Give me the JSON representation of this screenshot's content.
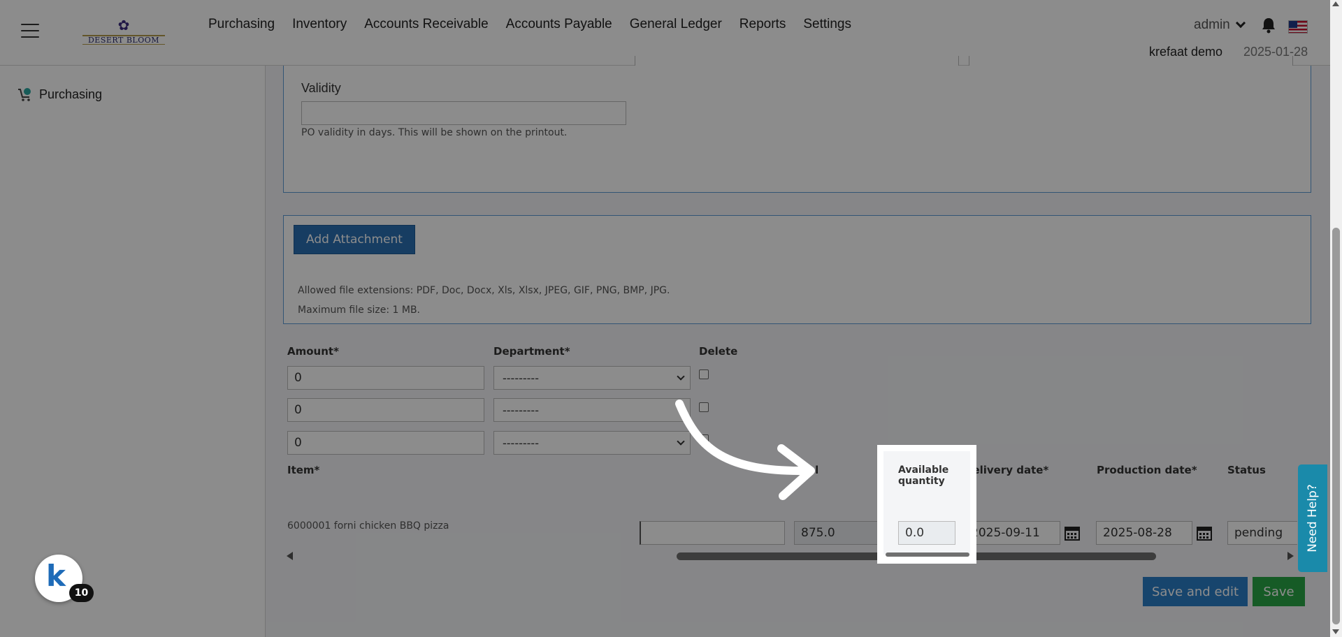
{
  "header": {
    "logo_text": "DESERT BLOOM",
    "nav": [
      "Purchasing",
      "Inventory",
      "Accounts Receivable",
      "Accounts Payable",
      "General Ledger",
      "Reports",
      "Settings"
    ],
    "user": "admin",
    "company": "krefaat demo",
    "date": "2025-01-28"
  },
  "sidebar": {
    "items": [
      {
        "label": "Purchasing",
        "icon": "cart-icon"
      }
    ]
  },
  "validity": {
    "label": "Validity",
    "value": "",
    "help": "PO validity in days. This will be shown on the printout."
  },
  "attachment": {
    "button": "Add Attachment",
    "extensions": "Allowed file extensions: PDF, Doc, Docx, Xls, Xlsx, JPEG, GIF, PNG, BMP, JPG.",
    "max_size": "Maximum file size: 1 MB."
  },
  "split": {
    "headers": {
      "amount": "Amount*",
      "department": "Department*",
      "delete": "Delete"
    },
    "rows": [
      {
        "amount": "0",
        "department": "---------"
      },
      {
        "amount": "0",
        "department": "---------"
      },
      {
        "amount": "0",
        "department": "---------"
      }
    ]
  },
  "items": {
    "headers": {
      "item": "Item*",
      "total_partial": "al",
      "available_quantity": "Available quantity",
      "delivery_partial": "Delivery date*",
      "production": "Production date*",
      "status": "Status"
    },
    "row": {
      "item": "6000001 forni chicken BBQ pizza",
      "total": "875.0",
      "available_quantity": "0.0",
      "delivery_date": "2025-09-11",
      "production_date": "2025-08-28",
      "status": "pending"
    }
  },
  "actions": {
    "save_and_edit": "Save and edit",
    "save": "Save"
  },
  "widgets": {
    "need_help": "Need Help?",
    "badge_count": "10",
    "badge_letter": "k"
  },
  "colors": {
    "primary": "#2b6fb2",
    "success": "#28a745",
    "help": "#1a8aaa",
    "panel_border": "#5b9bd5"
  }
}
